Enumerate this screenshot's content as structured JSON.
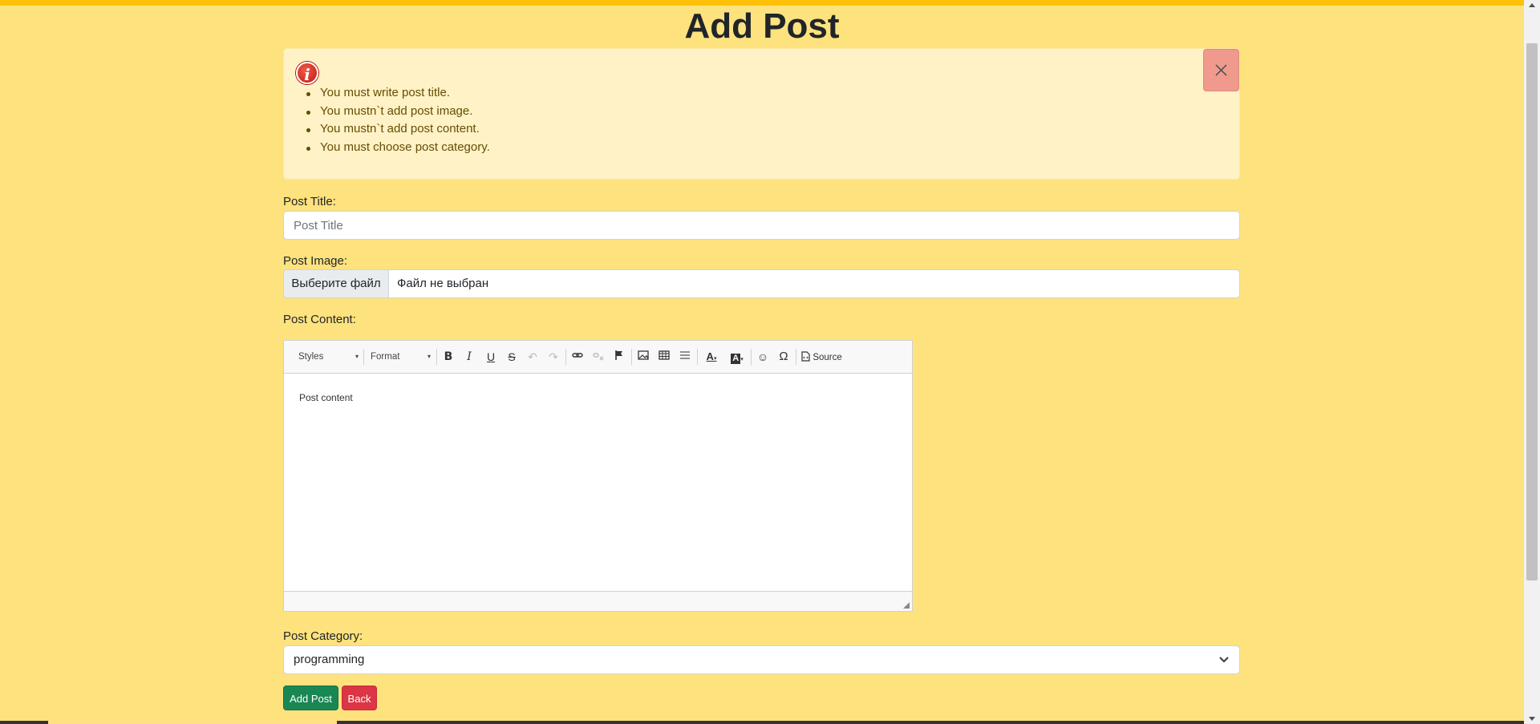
{
  "page": {
    "title": "Add Post"
  },
  "alert": {
    "icon": "info-icon",
    "messages": [
      "You must write post title.",
      "You mustn`t add post image.",
      "You mustn`t add post content.",
      "You must choose post category."
    ],
    "close_icon": "close-icon"
  },
  "form": {
    "title_label": "Post Title:",
    "title_placeholder": "Post Title",
    "image_label": "Post Image:",
    "file_button": "Выберите файл",
    "file_status": "Файл не выбран",
    "content_label": "Post Content:",
    "category_label": "Post Category:",
    "category_value": "programming"
  },
  "editor": {
    "styles_combo": "Styles",
    "format_combo": "Format",
    "source_label": "Source",
    "content": "Post content",
    "toolbar_icons": [
      "bold-icon",
      "italic-icon",
      "underline-icon",
      "strikethrough-icon",
      "undo-icon",
      "redo-icon",
      "link-icon",
      "unlink-icon",
      "anchor-icon",
      "image-icon",
      "table-icon",
      "horizontal-line-icon",
      "text-color-icon",
      "background-color-icon",
      "smiley-icon",
      "special-char-icon",
      "source-icon"
    ]
  },
  "buttons": {
    "add_post": "Add Post",
    "back": "Back"
  },
  "colors": {
    "page_bg": "#fde27e",
    "top_strip": "#ffc107",
    "alert_bg": "#fff2c6",
    "alert_close_bg": "#f09a8e",
    "add_button": "#198754",
    "back_button": "#dc3545"
  }
}
